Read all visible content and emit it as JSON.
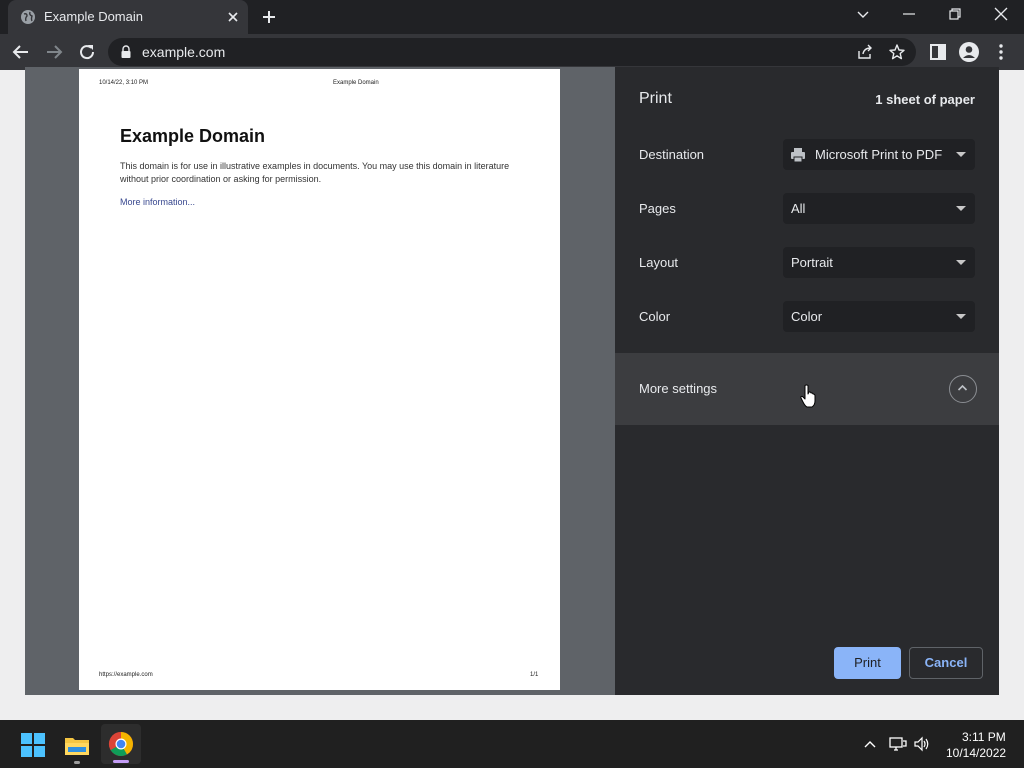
{
  "browser": {
    "tab": {
      "title": "Example Domain"
    },
    "address_bar": {
      "url": "example.com"
    }
  },
  "preview": {
    "header_date": "10/14/22, 3:10 PM",
    "header_title": "Example Domain",
    "heading": "Example Domain",
    "paragraph": "This domain is for use in illustrative examples in documents. You may use this domain in literature without prior coordination or asking for permission.",
    "link": "More information...",
    "footer_url": "https://example.com",
    "footer_page": "1/1"
  },
  "print_panel": {
    "title": "Print",
    "sheet_count": "1 sheet of paper",
    "destination": {
      "label": "Destination",
      "value": "Microsoft Print to PDF"
    },
    "pages": {
      "label": "Pages",
      "value": "All"
    },
    "layout": {
      "label": "Layout",
      "value": "Portrait"
    },
    "color": {
      "label": "Color",
      "value": "Color"
    },
    "more_settings": {
      "label": "More settings"
    },
    "print_button": "Print",
    "cancel_button": "Cancel"
  },
  "taskbar": {
    "time": "3:11 PM",
    "date": "10/14/2022",
    "apps": [
      "start-icon",
      "file-explorer-icon",
      "chrome-icon"
    ]
  },
  "colors": {
    "accent": "#8ab4f8",
    "panel_bg": "#292a2d",
    "preview_bg": "#5f6368"
  }
}
